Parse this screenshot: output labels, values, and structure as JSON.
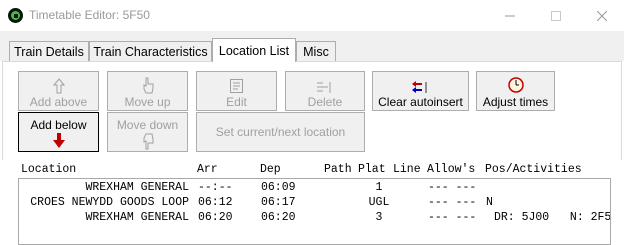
{
  "window": {
    "title": "Timetable Editor: 5F50"
  },
  "tabs": [
    {
      "label": "Train Details",
      "active": false
    },
    {
      "label": "Train Characteristics",
      "active": false
    },
    {
      "label": "Location List",
      "active": true
    },
    {
      "label": "Misc",
      "active": false
    }
  ],
  "buttons": {
    "add_above": "Add above",
    "move_up": "Move up",
    "edit": "Edit",
    "delete": "Delete",
    "clear_autoinsert": "Clear autoinsert",
    "adjust_times": "Adjust times",
    "add_below": "Add below",
    "move_down": "Move down",
    "set_current_next": "Set current/next location"
  },
  "list": {
    "headers": {
      "location": "Location",
      "arr": "Arr",
      "dep": "Dep",
      "path": "Path",
      "plat": "Plat",
      "line": "Line",
      "allows": "Allow's",
      "pos": "Pos/Activities"
    },
    "rows": [
      {
        "location": "WREXHAM GENERAL",
        "arr": "--:--",
        "dep": "06:09",
        "path": "",
        "plat": "1",
        "line": "",
        "allows": "--- ---",
        "pos": ""
      },
      {
        "location": "CROES NEWYDD GOODS LOOP",
        "arr": "06:12",
        "dep": "06:17",
        "path": "",
        "plat": "UGL",
        "line": "",
        "allows": "--- ---",
        "pos": "N"
      },
      {
        "location": "WREXHAM GENERAL",
        "arr": "06:20",
        "dep": "06:20",
        "path": "",
        "plat": "3",
        "line": "",
        "allows": "--- ---",
        "pos": "DR: 5J00   N: 2F5"
      }
    ]
  },
  "colors": {
    "accent_red": "#c00000",
    "accent_blue": "#0000c0",
    "disabled_text": "#a0a0a0"
  }
}
